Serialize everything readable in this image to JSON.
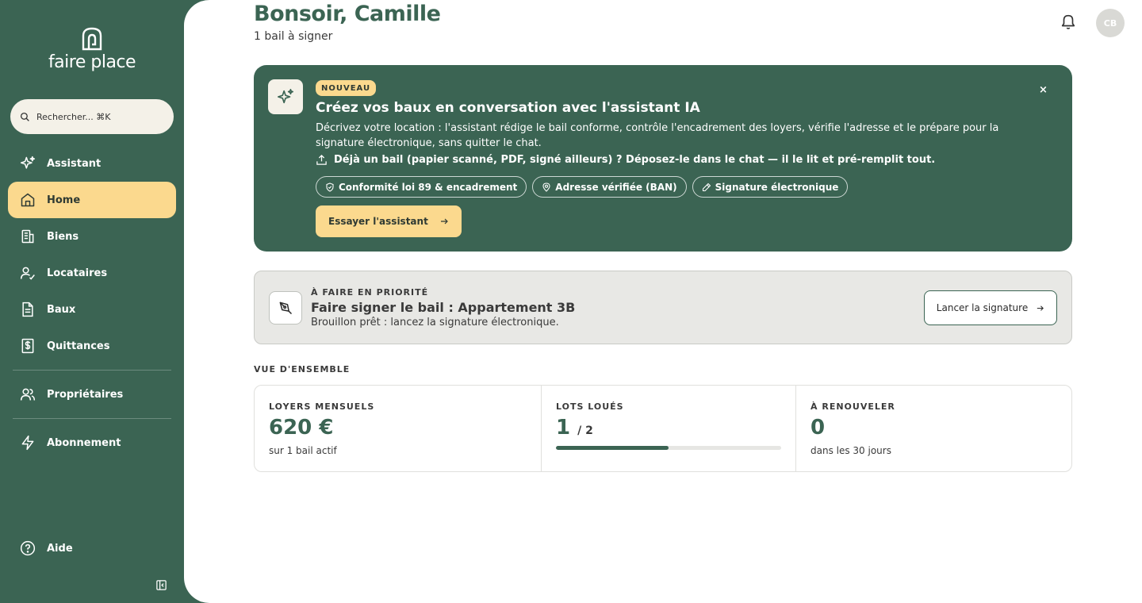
{
  "brand": {
    "name": "faire place"
  },
  "search": {
    "placeholder": "Rechercher... ⌘K"
  },
  "nav": {
    "items": [
      {
        "label": "Assistant",
        "icon": "sparkles-icon",
        "active": false
      },
      {
        "label": "Home",
        "icon": "home-icon",
        "active": true
      },
      {
        "label": "Biens",
        "icon": "building-icon",
        "active": false
      },
      {
        "label": "Locataires",
        "icon": "user-check-icon",
        "active": false
      },
      {
        "label": "Baux",
        "icon": "document-icon",
        "active": false
      },
      {
        "label": "Quittances",
        "icon": "receipt-dollar-icon",
        "active": false
      }
    ],
    "owners": {
      "label": "Propriétaires",
      "icon": "users-icon"
    },
    "subscription": {
      "label": "Abonnement",
      "icon": "lightning-icon"
    },
    "help": {
      "label": "Aide",
      "icon": "help-circle-icon"
    }
  },
  "header": {
    "greeting": "Bonsoir, Camille",
    "subtitle": "1 bail à signer",
    "avatar_initials": "CB"
  },
  "banner": {
    "badge": "NOUVEAU",
    "title": "Créez vos baux en conversation avec l'assistant IA",
    "description": "Décrivez votre location : l'assistant rédige le bail conforme, contrôle l'encadrement des loyers, vérifie l'adresse et le prépare pour la signature électronique, sans quitter le chat.",
    "upload_text": "Déjà un bail (papier scanné, PDF, signé ailleurs) ? Déposez-le dans le chat — il le lit et pré-remplit tout.",
    "chips": [
      {
        "label": "Conformité loi 89 & encadrement",
        "icon": "shield-check-icon"
      },
      {
        "label": "Adresse vérifiée (BAN)",
        "icon": "map-pin-icon"
      },
      {
        "label": "Signature électronique",
        "icon": "pen-icon"
      }
    ],
    "cta_label": "Essayer l'assistant",
    "close_label": "×"
  },
  "priority": {
    "eyebrow": "À FAIRE EN PRIORITÉ",
    "title": "Faire signer le bail : Appartement 3B",
    "description": "Brouillon prêt : lancez la signature électronique.",
    "button_label": "Lancer la signature"
  },
  "overview": {
    "label": "VUE D'ENSEMBLE",
    "rent": {
      "label": "LOYERS MENSUELS",
      "value": "620 €",
      "sub": "sur 1 bail actif"
    },
    "lots": {
      "label": "LOTS LOUÉS",
      "value": "1",
      "total": "/ 2",
      "fraction": 0.5
    },
    "renew": {
      "label": "À RENOUVELER",
      "value": "0",
      "sub": "dans les 30 jours"
    }
  },
  "colors": {
    "brand_green": "#3b6453",
    "accent_yellow": "#fbd98e",
    "cream": "#f4f1e8"
  }
}
